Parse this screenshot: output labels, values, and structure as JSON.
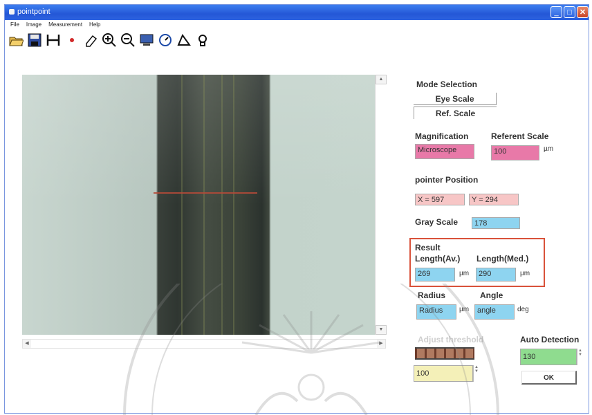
{
  "window": {
    "title": "pointpoint"
  },
  "menu": [
    "File",
    "Image",
    "Measurement",
    "Help"
  ],
  "toolbar": [
    "open-icon",
    "save-icon",
    "measure-icon",
    "point-icon",
    "eraser-icon",
    "zoom-in-icon",
    "zoom-out-icon",
    "monitor-icon",
    "clock-icon",
    "angle-icon",
    "lightbulb-icon"
  ],
  "mode": {
    "label": "Mode Selection",
    "eye": "Eye Scale",
    "ref": "Ref. Scale"
  },
  "magnification": {
    "label": "Magnification",
    "value": "Microscope"
  },
  "referent": {
    "label": "Referent Scale",
    "value": "100",
    "unit": "µm"
  },
  "pointer": {
    "label": "pointer Position",
    "x": "X = 597",
    "y": "Y = 294"
  },
  "gray": {
    "label": "Gray Scale",
    "value": "178"
  },
  "result": {
    "title": "Result",
    "avg_label": "Length(Av.)",
    "avg_value": "269",
    "avg_unit": "µm",
    "med_label": "Length(Med.)",
    "med_value": "290",
    "med_unit": "µm"
  },
  "radius": {
    "label": "Radius",
    "value": "Radius",
    "unit": "µm"
  },
  "angle": {
    "label": "Angle",
    "value": "angle",
    "unit": "deg"
  },
  "adjust": {
    "label": "Adjust threshold",
    "value": "100"
  },
  "auto": {
    "label": "Auto Detection",
    "value": "130",
    "ok": "OK"
  },
  "colors": {
    "pink": "#e879a8",
    "lightpink": "#f7c6c6",
    "blue": "#8ed4f0",
    "yellow": "#f4f0b8",
    "green": "#8fdc8f",
    "result_border": "#d9523a"
  }
}
